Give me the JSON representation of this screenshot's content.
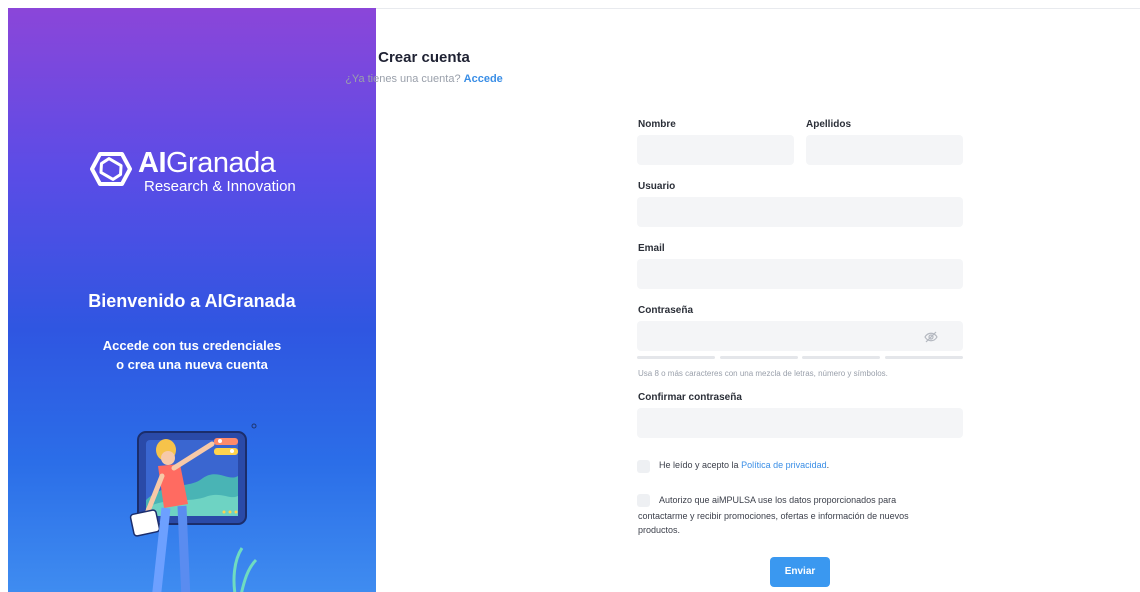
{
  "brand": {
    "name_bold": "AI",
    "name_rest": "Granada",
    "tagline": "Research & Innovation",
    "gradient": [
      "#8b46d9",
      "#2f56e1",
      "#3f8cf0"
    ]
  },
  "sidebar": {
    "welcome": "Bienvenido a AIGranada",
    "line1": "Accede con tus credenciales",
    "line2": "o crea una nueva cuenta",
    "illustration": "person-with-chart-illustration"
  },
  "form": {
    "title": "Crear cuenta",
    "login_prompt": "¿Ya tienes una cuenta?",
    "login_link": "Accede",
    "labels": {
      "nombre": "Nombre",
      "apellidos": "Apellidos",
      "usuario": "Usuario",
      "email": "Email",
      "password": "Contraseña",
      "confirm": "Confirmar contraseña"
    },
    "values": {
      "nombre": "",
      "apellidos": "",
      "usuario": "",
      "email": "",
      "password": "",
      "confirm": ""
    },
    "password_hint": "Usa 8 o más caracteres con una mezcla de letras, número y símbolos.",
    "privacy_prefix": "He leído y acepto la",
    "privacy_link": "Política de privacidad",
    "privacy_suffix": ".",
    "consent_line1": "Autorizo que aiMPULSA use los datos proporcionados para",
    "consent_line2": "contactarme y recibir promociones, ofertas e información de nuevos",
    "consent_line3": "productos.",
    "submit_label": "Enviar",
    "accent_color": "#3a98f0"
  }
}
